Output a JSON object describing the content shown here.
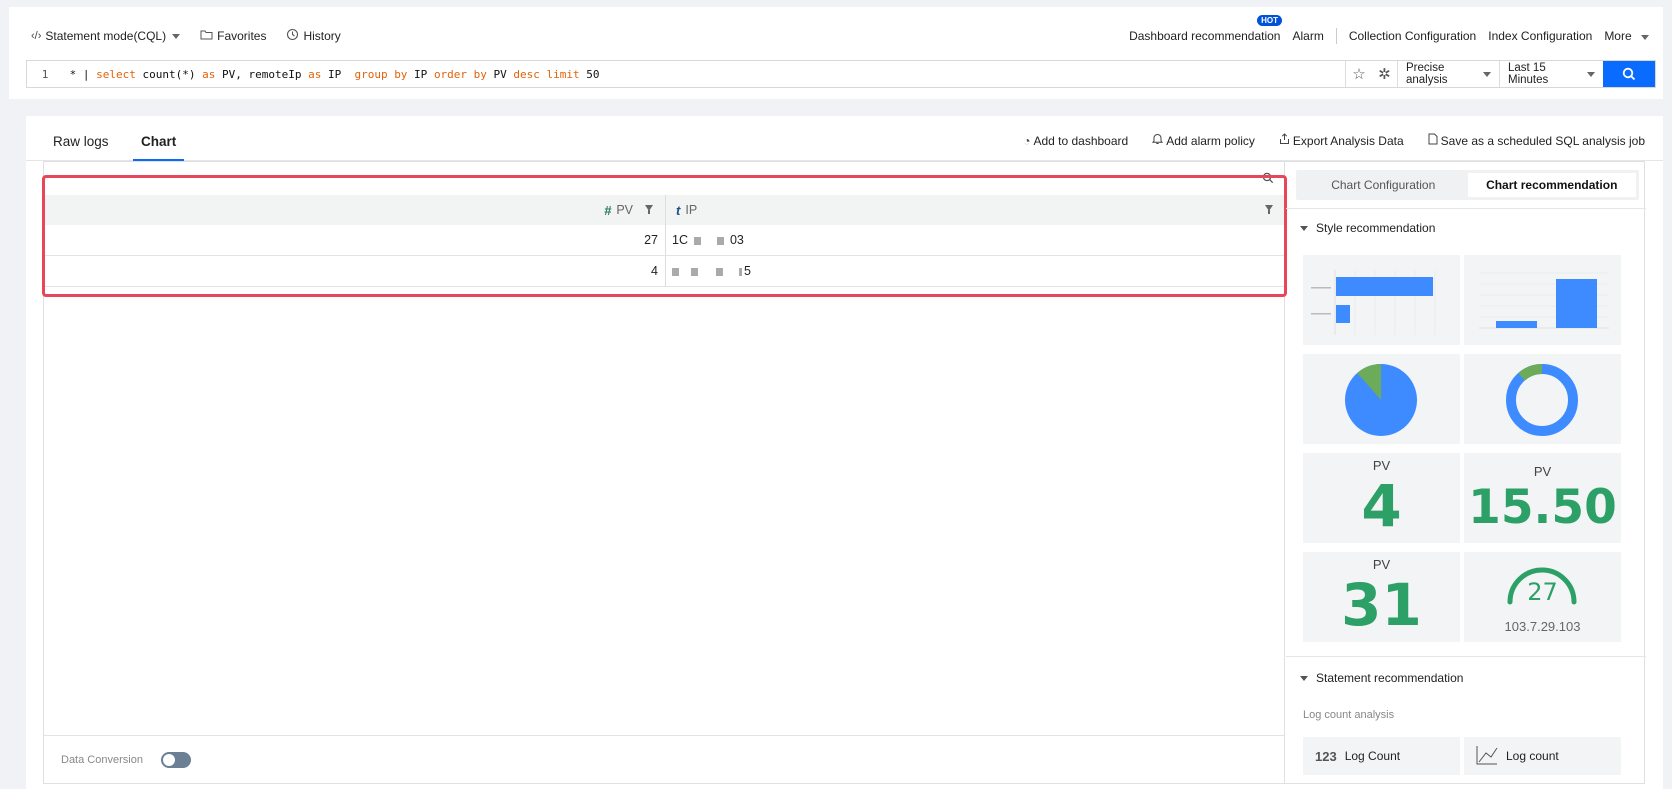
{
  "toolbar": {
    "mode_label": "Statement mode(CQL)",
    "favorites_label": "Favorites",
    "history_label": "History",
    "dashboard_rec_label": "Dashboard recommendation",
    "hot_badge": "HOT",
    "alarm_label": "Alarm",
    "collection_config_label": "Collection Configuration",
    "index_config_label": "Index Configuration",
    "more_label": "More"
  },
  "query": {
    "line_number": "1",
    "analysis_mode": "Precise analysis",
    "time_range": "Last 15 Minutes"
  },
  "tabs": {
    "raw_logs": "Raw logs",
    "chart": "Chart"
  },
  "actions": {
    "add_dashboard": "Add to dashboard",
    "add_alarm": "Add alarm policy",
    "export": "Export Analysis Data",
    "save_job": "Save as a scheduled SQL analysis job"
  },
  "table": {
    "columns": [
      {
        "type": "#",
        "name": "PV"
      },
      {
        "type": "t",
        "name": "IP"
      }
    ],
    "rows": [
      {
        "pv": "27",
        "ip_start": "1C",
        "ip_end": "03"
      },
      {
        "pv": "4",
        "ip_start": "",
        "ip_end": "5"
      }
    ]
  },
  "data_conversion_label": "Data Conversion",
  "side": {
    "tab_config": "Chart Configuration",
    "tab_recommend": "Chart recommendation",
    "style_rec_label": "Style recommendation",
    "metric1": {
      "label": "PV",
      "value": "4"
    },
    "metric2": {
      "label": "PV",
      "value": "15.50"
    },
    "metric3": {
      "label": "PV",
      "value": "31"
    },
    "gauge": {
      "value": "27",
      "ip": "103.7.29.103"
    },
    "statement_rec_label": "Statement recommendation",
    "log_count_analysis": "Log count analysis",
    "log_count_1": "Log Count",
    "log_count_2": "Log count"
  },
  "colors": {
    "accent": "#0a6cff",
    "metric": "#2ca067",
    "bar": "#3d8bff",
    "highlight": "#e8475a"
  }
}
